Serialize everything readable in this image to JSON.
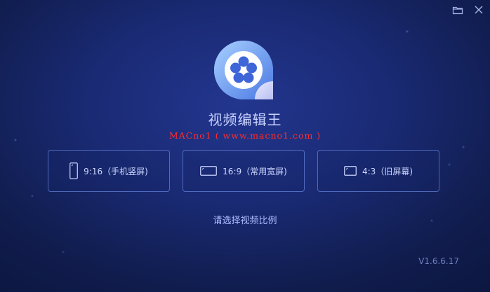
{
  "app": {
    "title": "视频编辑王",
    "watermark": "MACno1 ( www.macno1.com )",
    "version": "V1.6.6.17"
  },
  "window_controls": {
    "open_icon": "folder-icon",
    "close_icon": "close-icon"
  },
  "ratio_options": [
    {
      "label": "9:16（手机竖屏)",
      "icon": "portrait-phone-icon"
    },
    {
      "label": "16:9（常用宽屏)",
      "icon": "widescreen-icon"
    },
    {
      "label": "4:3（旧屏幕)",
      "icon": "old-screen-icon"
    }
  ],
  "prompt": "请选择视频比例",
  "colors": {
    "background": "#1a2a74",
    "logo_gradient_start": "#9cc7ff",
    "logo_gradient_end": "#4f7ee8",
    "watermark": "#ff2d2d",
    "card_border": "#7da0ff"
  }
}
